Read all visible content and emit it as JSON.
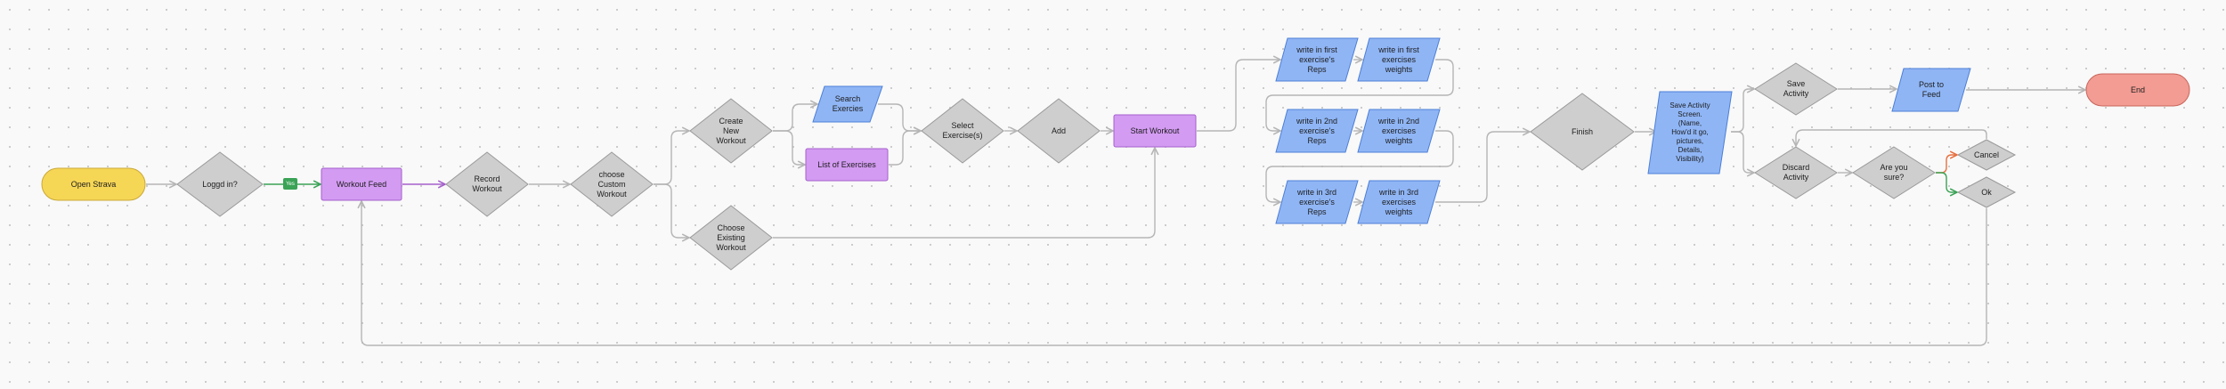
{
  "diagram": {
    "nodes": [
      {
        "id": "open-strava",
        "label": "Open Strava",
        "shape": "terminator",
        "fill": "#f6d655",
        "stroke": "#c9a93a"
      },
      {
        "id": "logged-in",
        "label": "Loggd in?",
        "shape": "diamond",
        "fill": "#cfcece",
        "stroke": "#9a9a9a"
      },
      {
        "id": "workout-feed",
        "label": "Workout Feed",
        "shape": "rect",
        "fill": "#d39bf2",
        "stroke": "#a560cc"
      },
      {
        "id": "record-workout",
        "label": "Record\nWorkout",
        "shape": "diamond",
        "fill": "#cfcece",
        "stroke": "#9a9a9a"
      },
      {
        "id": "choose-custom",
        "label": "choose\nCustom\nWorkout",
        "shape": "diamond",
        "fill": "#cfcece",
        "stroke": "#9a9a9a"
      },
      {
        "id": "create-new",
        "label": "Create\nNew\nWorkout",
        "shape": "diamond",
        "fill": "#cfcece",
        "stroke": "#9a9a9a"
      },
      {
        "id": "choose-existing",
        "label": "Choose\nExisting\nWorkout",
        "shape": "diamond",
        "fill": "#cfcece",
        "stroke": "#9a9a9a"
      },
      {
        "id": "search-exercises",
        "label": "Search\nExercies",
        "shape": "parallelogram",
        "fill": "#8fb5f5",
        "stroke": "#4c7fd6"
      },
      {
        "id": "list-exercises",
        "label": "List of Exercises",
        "shape": "rect",
        "fill": "#d39bf2",
        "stroke": "#a560cc"
      },
      {
        "id": "select-exercises",
        "label": "Select\nExercise(s)",
        "shape": "diamond",
        "fill": "#cfcece",
        "stroke": "#9a9a9a"
      },
      {
        "id": "add",
        "label": "Add",
        "shape": "diamond",
        "fill": "#cfcece",
        "stroke": "#9a9a9a"
      },
      {
        "id": "start-workout",
        "label": "Start Workout",
        "shape": "rect",
        "fill": "#d39bf2",
        "stroke": "#a560cc"
      },
      {
        "id": "first-reps",
        "label": "write in first\nexercise's\nReps",
        "shape": "parallelogram",
        "fill": "#8fb5f5",
        "stroke": "#4c7fd6"
      },
      {
        "id": "first-weights",
        "label": "write in first\nexercises\nweights",
        "shape": "parallelogram",
        "fill": "#8fb5f5",
        "stroke": "#4c7fd6"
      },
      {
        "id": "second-reps",
        "label": "write in 2nd\nexercise's\nReps",
        "shape": "parallelogram",
        "fill": "#8fb5f5",
        "stroke": "#4c7fd6"
      },
      {
        "id": "second-weights",
        "label": "write in 2nd\nexercises\nweights",
        "shape": "parallelogram",
        "fill": "#8fb5f5",
        "stroke": "#4c7fd6"
      },
      {
        "id": "third-reps",
        "label": "write in 3rd\nexercise's\nReps",
        "shape": "parallelogram",
        "fill": "#8fb5f5",
        "stroke": "#4c7fd6"
      },
      {
        "id": "third-weights",
        "label": "write in 3rd\nexercises\nweights",
        "shape": "parallelogram",
        "fill": "#8fb5f5",
        "stroke": "#4c7fd6"
      },
      {
        "id": "finish",
        "label": "Finish",
        "shape": "diamond",
        "fill": "#cfcece",
        "stroke": "#9a9a9a"
      },
      {
        "id": "save-activity-screen",
        "label": "Save Activity\nScreen.\n(Name,\nHow'd it go,\npictures,\nDetails,\nVisibility)",
        "shape": "parallelogram",
        "fill": "#8fb5f5",
        "stroke": "#4c7fd6"
      },
      {
        "id": "save-activity",
        "label": "Save\nActivity",
        "shape": "diamond",
        "fill": "#cfcece",
        "stroke": "#9a9a9a"
      },
      {
        "id": "post-to-feed",
        "label": "Post to\nFeed",
        "shape": "parallelogram",
        "fill": "#8fb5f5",
        "stroke": "#4c7fd6"
      },
      {
        "id": "end",
        "label": "End",
        "shape": "terminator",
        "fill": "#f29c93",
        "stroke": "#c9655b"
      },
      {
        "id": "discard-activity",
        "label": "Discard\nActivity",
        "shape": "diamond",
        "fill": "#cfcece",
        "stroke": "#9a9a9a"
      },
      {
        "id": "are-you-sure",
        "label": "Are you\nsure?",
        "shape": "diamond",
        "fill": "#cfcece",
        "stroke": "#9a9a9a"
      },
      {
        "id": "cancel",
        "label": "Cancel",
        "shape": "diamond",
        "fill": "#cfcece",
        "stroke": "#9a9a9a"
      },
      {
        "id": "ok",
        "label": "Ok",
        "shape": "diamond",
        "fill": "#cfcece",
        "stroke": "#9a9a9a"
      }
    ],
    "edges": [
      {
        "from": "open-strava",
        "to": "logged-in",
        "color": "#b5b5b5"
      },
      {
        "from": "logged-in",
        "to": "workout-feed",
        "color": "#3aa356",
        "label": "Yes"
      },
      {
        "from": "workout-feed",
        "to": "record-workout",
        "color": "#a560cc"
      },
      {
        "from": "record-workout",
        "to": "choose-custom",
        "color": "#b5b5b5"
      },
      {
        "from": "choose-custom",
        "to": "create-new",
        "color": "#b5b5b5"
      },
      {
        "from": "choose-custom",
        "to": "choose-existing",
        "color": "#b5b5b5"
      },
      {
        "from": "create-new",
        "to": "search-exercises",
        "color": "#b5b5b5"
      },
      {
        "from": "create-new",
        "to": "list-exercises",
        "color": "#b5b5b5"
      },
      {
        "from": "search-exercises",
        "to": "select-exercises",
        "color": "#b5b5b5"
      },
      {
        "from": "list-exercises",
        "to": "select-exercises",
        "color": "#b5b5b5"
      },
      {
        "from": "select-exercises",
        "to": "add",
        "color": "#b5b5b5"
      },
      {
        "from": "add",
        "to": "start-workout",
        "color": "#b5b5b5"
      },
      {
        "from": "choose-existing",
        "to": "start-workout",
        "color": "#b5b5b5"
      },
      {
        "from": "start-workout",
        "to": "first-reps",
        "color": "#b5b5b5"
      },
      {
        "from": "first-reps",
        "to": "first-weights",
        "color": "#b5b5b5"
      },
      {
        "from": "first-weights",
        "to": "second-reps",
        "color": "#b5b5b5"
      },
      {
        "from": "second-reps",
        "to": "second-weights",
        "color": "#b5b5b5"
      },
      {
        "from": "second-weights",
        "to": "third-reps",
        "color": "#b5b5b5"
      },
      {
        "from": "third-reps",
        "to": "third-weights",
        "color": "#b5b5b5"
      },
      {
        "from": "third-weights",
        "to": "finish",
        "color": "#b5b5b5"
      },
      {
        "from": "finish",
        "to": "save-activity-screen",
        "color": "#b5b5b5"
      },
      {
        "from": "save-activity-screen",
        "to": "save-activity",
        "color": "#b5b5b5"
      },
      {
        "from": "save-activity-screen",
        "to": "discard-activity",
        "color": "#b5b5b5"
      },
      {
        "from": "save-activity",
        "to": "post-to-feed",
        "color": "#b5b5b5"
      },
      {
        "from": "post-to-feed",
        "to": "end",
        "color": "#b5b5b5"
      },
      {
        "from": "discard-activity",
        "to": "are-you-sure",
        "color": "#b5b5b5"
      },
      {
        "from": "are-you-sure",
        "to": "cancel",
        "color": "#e8703f"
      },
      {
        "from": "are-you-sure",
        "to": "ok",
        "color": "#3aa356"
      },
      {
        "from": "cancel",
        "to": "discard-activity",
        "color": "#b5b5b5"
      },
      {
        "from": "ok",
        "to": "workout-feed",
        "color": "#b5b5b5"
      }
    ]
  }
}
